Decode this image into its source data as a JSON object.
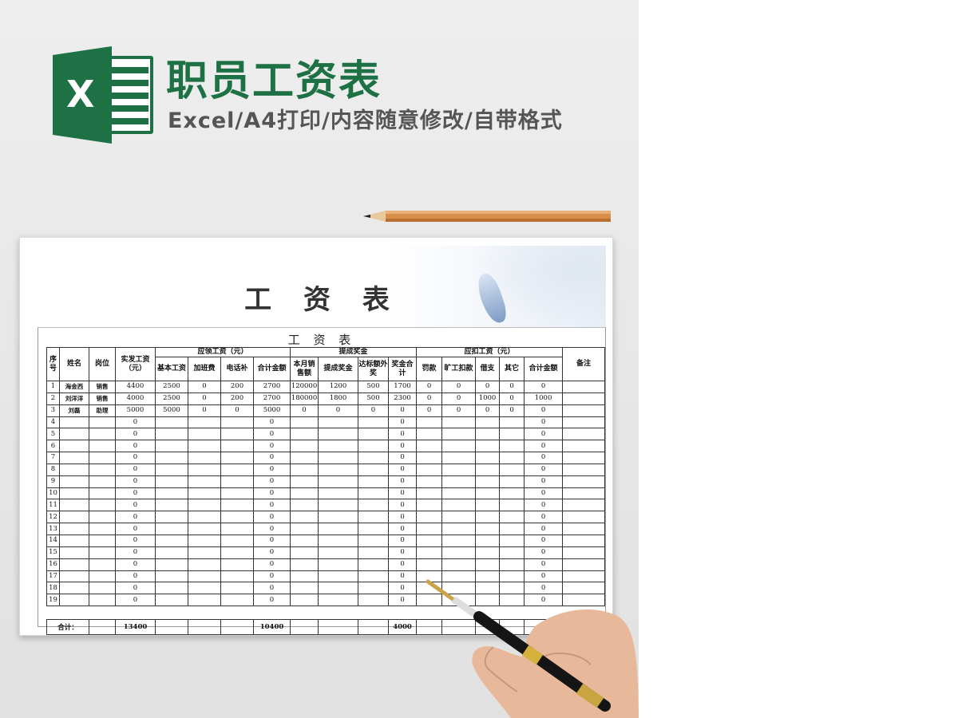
{
  "header": {
    "title": "职员工资表",
    "subtitle": "Excel/A4打印/内容随意修改/自带格式",
    "logo_letter": "X",
    "accent_color": "#1e7145"
  },
  "paper": {
    "big_title": "工 资 表",
    "table_title": "工 资 表"
  },
  "table": {
    "groups": {
      "seq": "序号",
      "name": "姓名",
      "position": "岗位",
      "actual_pay": "实发工资（元）",
      "payable": "应领工资（元）",
      "bonus": "提成奖金",
      "deduct": "应扣工资（元）",
      "remark": "备注"
    },
    "sub_headers": [
      "基本工资",
      "加班费",
      "电话补",
      "合计金额",
      "本月销售额",
      "提成奖金",
      "达标额外奖",
      "奖金合计",
      "罚款",
      "旷工扣款",
      "借支",
      "其它",
      "合计金额"
    ],
    "rows": [
      [
        "1",
        "海金西",
        "销售",
        "4400",
        "2500",
        "0",
        "200",
        "2700",
        "120000",
        "1200",
        "500",
        "1700",
        "0",
        "0",
        "0",
        "0",
        "0",
        ""
      ],
      [
        "2",
        "刘洋洋",
        "销售",
        "4000",
        "2500",
        "0",
        "200",
        "2700",
        "180000",
        "1800",
        "500",
        "2300",
        "0",
        "0",
        "1000",
        "0",
        "1000",
        ""
      ],
      [
        "3",
        "刘磊",
        "助理",
        "5000",
        "5000",
        "0",
        "0",
        "5000",
        "0",
        "0",
        "0",
        "0",
        "0",
        "0",
        "0",
        "0",
        "0",
        ""
      ],
      [
        "4",
        "",
        "",
        "0",
        "",
        "",
        "",
        "0",
        "",
        "",
        "",
        "0",
        "",
        "",
        "",
        "",
        "0",
        ""
      ],
      [
        "5",
        "",
        "",
        "0",
        "",
        "",
        "",
        "0",
        "",
        "",
        "",
        "0",
        "",
        "",
        "",
        "",
        "0",
        ""
      ],
      [
        "6",
        "",
        "",
        "0",
        "",
        "",
        "",
        "0",
        "",
        "",
        "",
        "0",
        "",
        "",
        "",
        "",
        "0",
        ""
      ],
      [
        "7",
        "",
        "",
        "0",
        "",
        "",
        "",
        "0",
        "",
        "",
        "",
        "0",
        "",
        "",
        "",
        "",
        "0",
        ""
      ],
      [
        "8",
        "",
        "",
        "0",
        "",
        "",
        "",
        "0",
        "",
        "",
        "",
        "0",
        "",
        "",
        "",
        "",
        "0",
        ""
      ],
      [
        "9",
        "",
        "",
        "0",
        "",
        "",
        "",
        "0",
        "",
        "",
        "",
        "0",
        "",
        "",
        "",
        "",
        "0",
        ""
      ],
      [
        "10",
        "",
        "",
        "0",
        "",
        "",
        "",
        "0",
        "",
        "",
        "",
        "0",
        "",
        "",
        "",
        "",
        "0",
        ""
      ],
      [
        "11",
        "",
        "",
        "0",
        "",
        "",
        "",
        "0",
        "",
        "",
        "",
        "0",
        "",
        "",
        "",
        "",
        "0",
        ""
      ],
      [
        "12",
        "",
        "",
        "0",
        "",
        "",
        "",
        "0",
        "",
        "",
        "",
        "0",
        "",
        "",
        "",
        "",
        "0",
        ""
      ],
      [
        "13",
        "",
        "",
        "0",
        "",
        "",
        "",
        "0",
        "",
        "",
        "",
        "0",
        "",
        "",
        "",
        "",
        "0",
        ""
      ],
      [
        "14",
        "",
        "",
        "0",
        "",
        "",
        "",
        "0",
        "",
        "",
        "",
        "0",
        "",
        "",
        "",
        "",
        "0",
        ""
      ],
      [
        "15",
        "",
        "",
        "0",
        "",
        "",
        "",
        "0",
        "",
        "",
        "",
        "0",
        "",
        "",
        "",
        "",
        "0",
        ""
      ],
      [
        "16",
        "",
        "",
        "0",
        "",
        "",
        "",
        "0",
        "",
        "",
        "",
        "0",
        "",
        "",
        "",
        "",
        "0",
        ""
      ],
      [
        "17",
        "",
        "",
        "0",
        "",
        "",
        "",
        "0",
        "",
        "",
        "",
        "0",
        "",
        "",
        "",
        "",
        "0",
        ""
      ],
      [
        "18",
        "",
        "",
        "0",
        "",
        "",
        "",
        "0",
        "",
        "",
        "",
        "0",
        "",
        "",
        "",
        "",
        "0",
        ""
      ],
      [
        "19",
        "",
        "",
        "0",
        "",
        "",
        "",
        "0",
        "",
        "",
        "",
        "0",
        "",
        "",
        "",
        "",
        "0",
        ""
      ]
    ],
    "total": {
      "label": "合计：",
      "actual_pay": "13400",
      "payable_total": "10400",
      "bonus_total": "4000"
    }
  }
}
